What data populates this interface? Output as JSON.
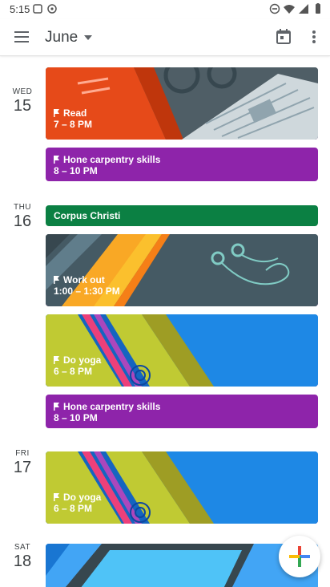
{
  "status_bar": {
    "time": "5:15",
    "icons": [
      "notification-icon",
      "sync-icon",
      "dnd-icon",
      "wifi-icon",
      "signal-icon",
      "battery-icon"
    ]
  },
  "app_bar": {
    "month": "June",
    "icons": [
      "menu-icon",
      "chevron-down-icon",
      "calendar-today-icon",
      "more-vert-icon"
    ]
  },
  "days": [
    {
      "dow": "WED",
      "num": "15",
      "events": [
        {
          "title": "Read",
          "time": "7 – 8 PM",
          "style": "image-reading"
        },
        {
          "title": "Hone carpentry skills",
          "time": "8 – 10 PM",
          "style": "purple"
        }
      ]
    },
    {
      "dow": "THU",
      "num": "16",
      "events": [
        {
          "title": "Corpus Christi",
          "time": "",
          "style": "teal-holiday"
        },
        {
          "title": "Work out",
          "time": "1:00 – 1:30 PM",
          "style": "image-workout"
        },
        {
          "title": "Do yoga",
          "time": "6 – 8 PM",
          "style": "image-yoga"
        },
        {
          "title": "Hone carpentry skills",
          "time": "8 – 10 PM",
          "style": "purple"
        }
      ]
    },
    {
      "dow": "FRI",
      "num": "17",
      "events": [
        {
          "title": "Do yoga",
          "time": "6 – 8 PM",
          "style": "image-yoga"
        }
      ]
    },
    {
      "dow": "SAT",
      "num": "18",
      "events": []
    }
  ],
  "colors": {
    "purple": "#8e24aa",
    "teal": "#0b8043",
    "accent": "#1a73e8"
  }
}
